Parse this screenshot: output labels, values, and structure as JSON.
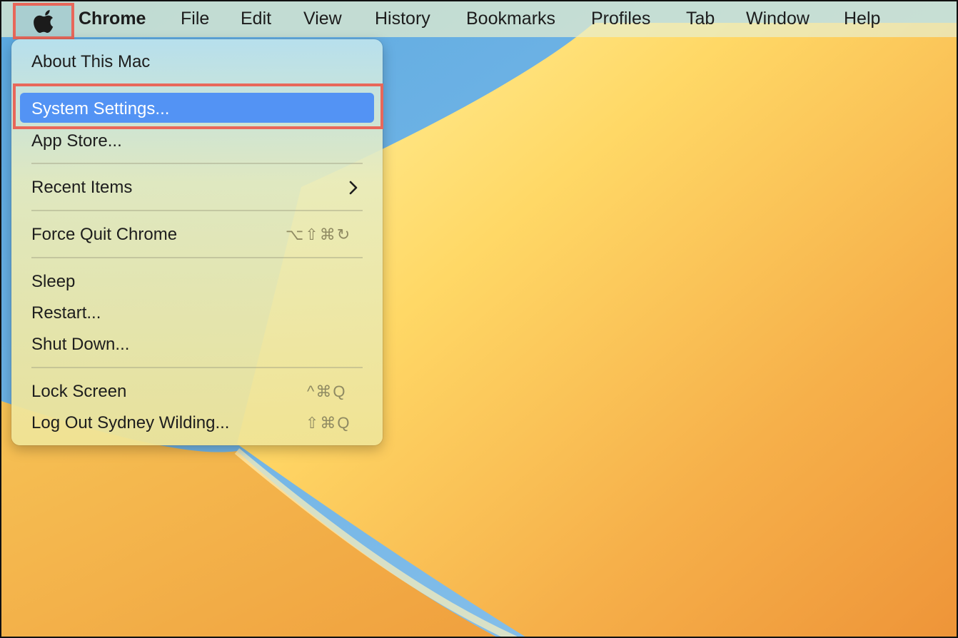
{
  "menubar": {
    "app_name": "Chrome",
    "menus": [
      "File",
      "Edit",
      "View",
      "History",
      "Bookmarks",
      "Profiles",
      "Tab",
      "Window",
      "Help"
    ],
    "apple_icon": "apple-logo-icon"
  },
  "apple_menu": {
    "items": [
      {
        "label": "About This Mac"
      },
      {
        "label": "System Settings...",
        "highlighted": true
      },
      {
        "label": "App Store..."
      },
      {
        "label": "Recent Items",
        "submenu": true
      },
      {
        "label": "Force Quit Chrome",
        "shortcut": "⌥⇧⌘↻"
      },
      {
        "label": "Sleep"
      },
      {
        "label": "Restart..."
      },
      {
        "label": "Shut Down..."
      },
      {
        "label": "Lock Screen",
        "shortcut": "^⌘Q"
      },
      {
        "label": "Log Out Sydney Wilding...",
        "shortcut": "⇧⌘Q"
      }
    ]
  },
  "colors": {
    "highlight": "#5393f4",
    "annotation_box": "#e8675a"
  }
}
